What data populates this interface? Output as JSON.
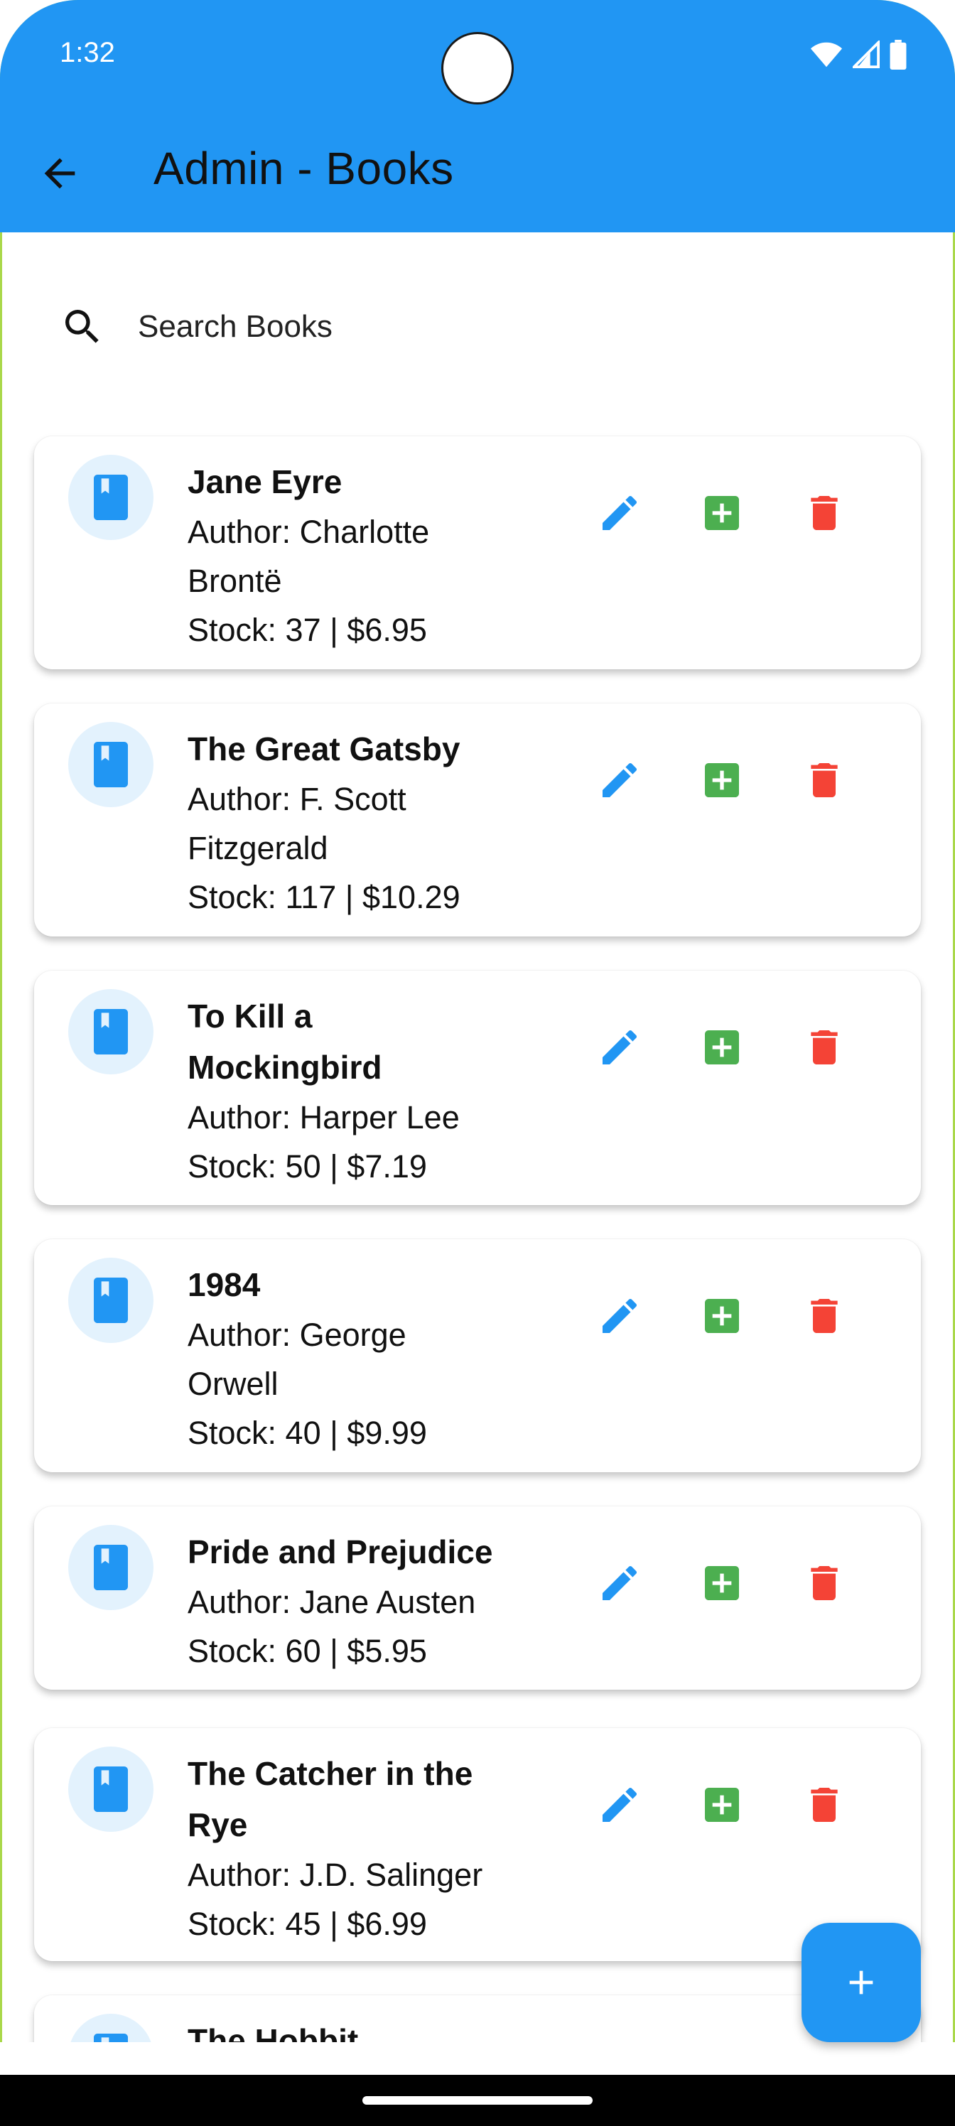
{
  "status_bar": {
    "time": "1:32",
    "icons": [
      "wifi-icon",
      "signal-icon",
      "battery-icon"
    ]
  },
  "app_bar": {
    "title": "Admin - Books",
    "back_icon": "arrow-back-icon"
  },
  "search": {
    "placeholder": "Search Books",
    "icon": "search-icon"
  },
  "books": [
    {
      "title": "Jane Eyre",
      "author_line": "Author: Charlotte",
      "author_line2": "Brontë",
      "stock_line": "Stock: 37 | $6.95"
    },
    {
      "title": "The Great Gatsby",
      "author_line": "Author: F. Scott",
      "author_line2": "Fitzgerald",
      "stock_line": "Stock: 117 | $10.29"
    },
    {
      "title": "To Kill a",
      "title_line2": "Mockingbird",
      "author_line": "Author: Harper Lee",
      "stock_line": "Stock: 50 | $7.19"
    },
    {
      "title": "1984",
      "author_line": "Author: George",
      "author_line2": "Orwell",
      "stock_line": "Stock: 40 | $9.99"
    },
    {
      "title": "Pride and Prejudice",
      "author_line": "Author: Jane Austen",
      "stock_line": "Stock: 60 | $5.95"
    },
    {
      "title": "The Catcher in the",
      "title_line2": "Rye",
      "author_line": "Author: J.D. Salinger",
      "stock_line": "Stock: 45 | $6.99"
    },
    {
      "title": "The Hobbit"
    }
  ],
  "actions": {
    "edit_icon": "pencil-icon",
    "add_stock_icon": "add-box-icon",
    "delete_icon": "trash-icon"
  },
  "fab": {
    "icon": "plus-icon"
  },
  "colors": {
    "primary": "#2196f3",
    "edit": "#2196f3",
    "add": "#4caf50",
    "delete": "#f44336",
    "avatar_bg": "#e3f2fd"
  }
}
